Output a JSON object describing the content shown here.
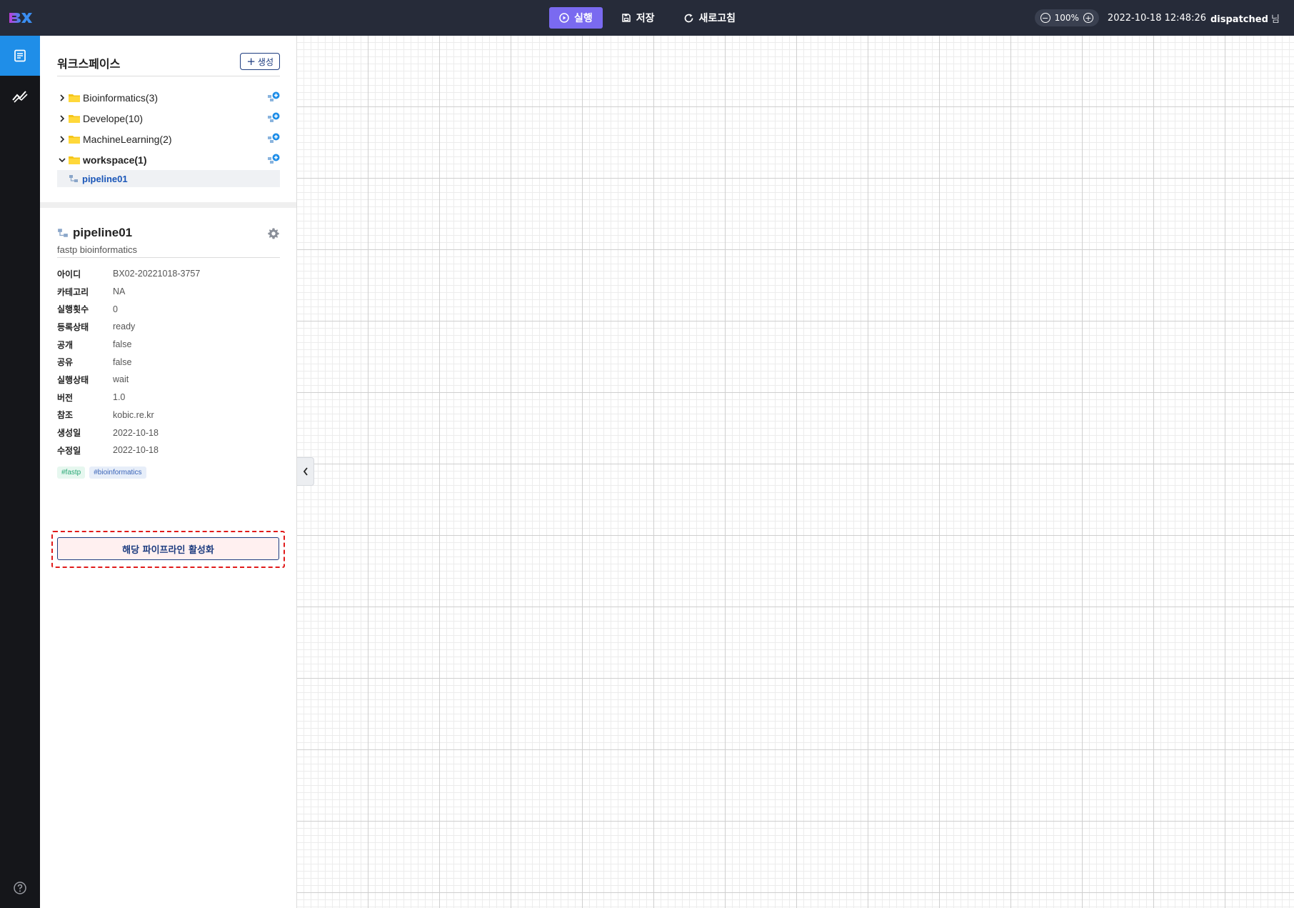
{
  "topbar": {
    "run_label": "실행",
    "save_label": "저장",
    "refresh_label": "새로고침",
    "zoom_value": "100%",
    "datetime": "2022-10-18 12:48:26",
    "user_name": "dispatched",
    "user_suffix": "님"
  },
  "workspace": {
    "title": "워크스페이스",
    "create_label": "생성",
    "folders": [
      {
        "label": "Bioinformatics(3)",
        "expanded": false
      },
      {
        "label": "Develope(10)",
        "expanded": false
      },
      {
        "label": "MachineLearning(2)",
        "expanded": false
      },
      {
        "label": "workspace(1)",
        "expanded": true
      }
    ],
    "child": "pipeline01"
  },
  "detail": {
    "title": "pipeline01",
    "subtitle": "fastp bioinformatics",
    "props": [
      {
        "k": "아이디",
        "v": "BX02-20221018-3757"
      },
      {
        "k": "카테고리",
        "v": "NA"
      },
      {
        "k": "실행횟수",
        "v": "0"
      },
      {
        "k": "등록상태",
        "v": "ready"
      },
      {
        "k": "공개",
        "v": "false"
      },
      {
        "k": "공유",
        "v": "false"
      },
      {
        "k": "실행상태",
        "v": "wait"
      },
      {
        "k": "버전",
        "v": "1.0"
      },
      {
        "k": "참조",
        "v": "kobic.re.kr"
      },
      {
        "k": "생성일",
        "v": "2022-10-18"
      },
      {
        "k": "수정일",
        "v": "2022-10-18"
      }
    ],
    "tags": [
      "#fastp",
      "#bioinformatics"
    ],
    "activate_label": "해당 파이프라인 활성화"
  },
  "colors": {
    "topbar": "#262b39",
    "accent_run": "#7a6af0",
    "rail_active": "#1f8ee8",
    "navy": "#1e3d80",
    "highlight_dashed": "#e01a1a"
  }
}
